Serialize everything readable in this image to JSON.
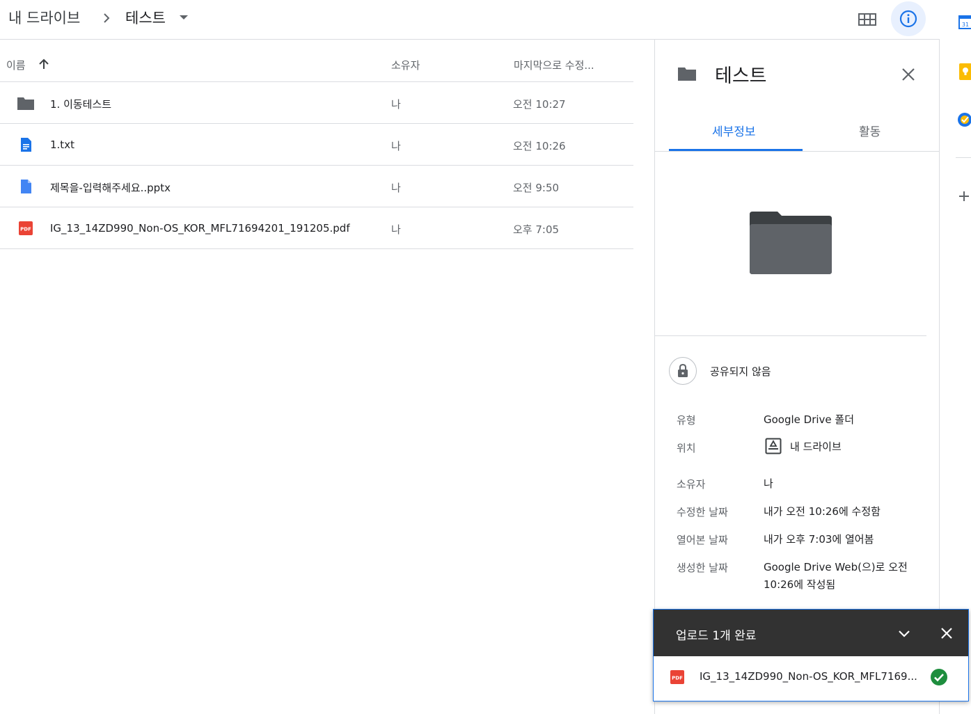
{
  "header": {
    "breadcrumb_root": "내 드라이브",
    "breadcrumb_current": "테스트"
  },
  "list": {
    "headers": {
      "name": "이름",
      "owner": "소유자",
      "modified": "마지막으로 수정..."
    },
    "rows": [
      {
        "icon": "folder-icon",
        "name": "1. 이동테스트",
        "owner": "나",
        "modified": "오전 10:27"
      },
      {
        "icon": "docs-icon",
        "name": "1.txt",
        "owner": "나",
        "modified": "오전 10:26"
      },
      {
        "icon": "file-icon",
        "name": "제목을-입력해주세요..pptx",
        "owner": "나",
        "modified": "오전 9:50"
      },
      {
        "icon": "pdf-icon",
        "name": "IG_13_14ZD990_Non-OS_KOR_MFL71694201_191205.pdf",
        "owner": "나",
        "modified": "오후 7:05"
      }
    ]
  },
  "panel": {
    "title": "테스트",
    "tabs": [
      "세부정보",
      "활동"
    ],
    "sharing": "공유되지 않음",
    "details": {
      "type_label": "유형",
      "type_value": "Google Drive 폴더",
      "location_label": "위치",
      "location_value": "내 드라이브",
      "owner_label": "소유자",
      "owner_value": "나",
      "modified_label": "수정한 날짜",
      "modified_value": "내가 오전 10:26에 수정함",
      "opened_label": "열어본 날짜",
      "opened_value": "내가 오후 7:03에 열어봄",
      "created_label": "생성한 날짜",
      "created_value_line1": "Google Drive Web(으)로 오전",
      "created_value_line2": "10:26에 작성됨"
    }
  },
  "toast": {
    "title": "업로드 1개 완료",
    "file_name": "IG_13_14ZD990_Non-OS_KOR_MFL7169..."
  },
  "colors": {
    "accent": "#1a73e8",
    "toast_bg": "#323232",
    "success": "#1e8e3e",
    "pdf_red": "#ea4335"
  }
}
